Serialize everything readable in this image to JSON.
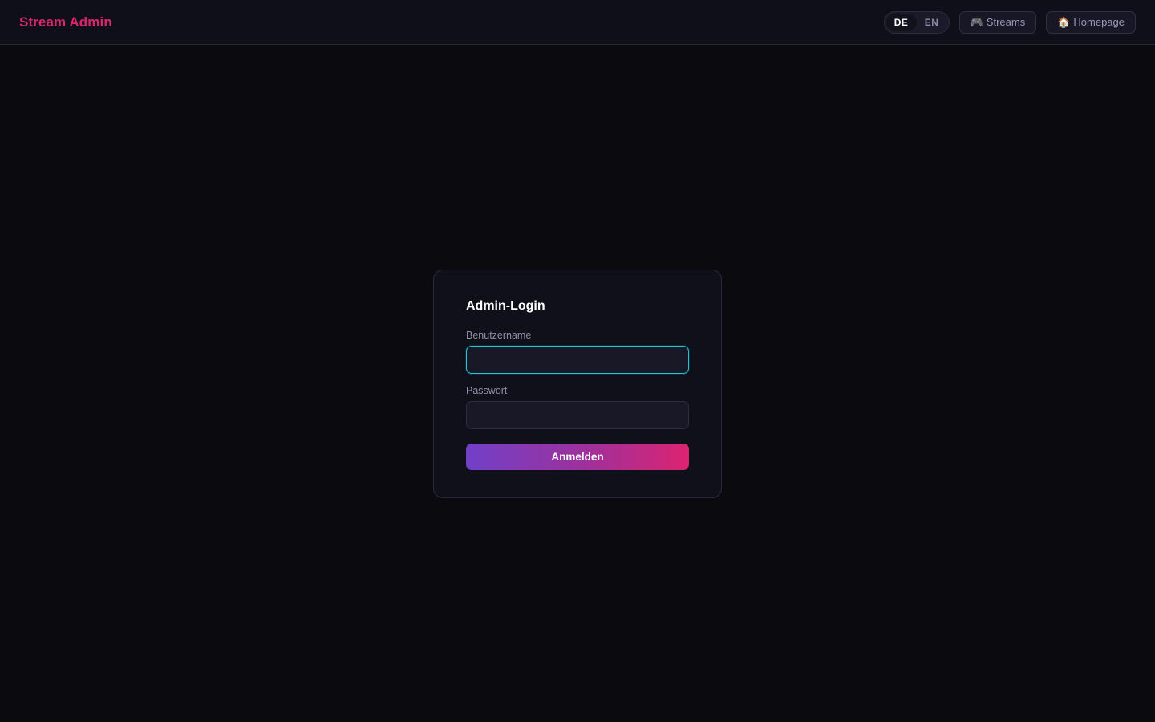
{
  "header": {
    "brand": "Stream Admin",
    "language": {
      "options": [
        "DE",
        "EN"
      ],
      "active": "DE"
    },
    "nav": [
      {
        "icon": "🎮",
        "icon_name": "gamepad-icon",
        "label": "Streams"
      },
      {
        "icon": "🏠",
        "icon_name": "house-icon",
        "label": "Homepage"
      }
    ]
  },
  "login": {
    "title": "Admin-Login",
    "username_label": "Benutzername",
    "username_value": "",
    "password_label": "Passwort",
    "password_value": "",
    "submit_label": "Anmelden"
  },
  "colors": {
    "accent": "#d9246f",
    "focus": "#1ec6d8",
    "gradient_start": "#7040c8",
    "gradient_end": "#dc2470",
    "background": "#0a0a0f"
  }
}
